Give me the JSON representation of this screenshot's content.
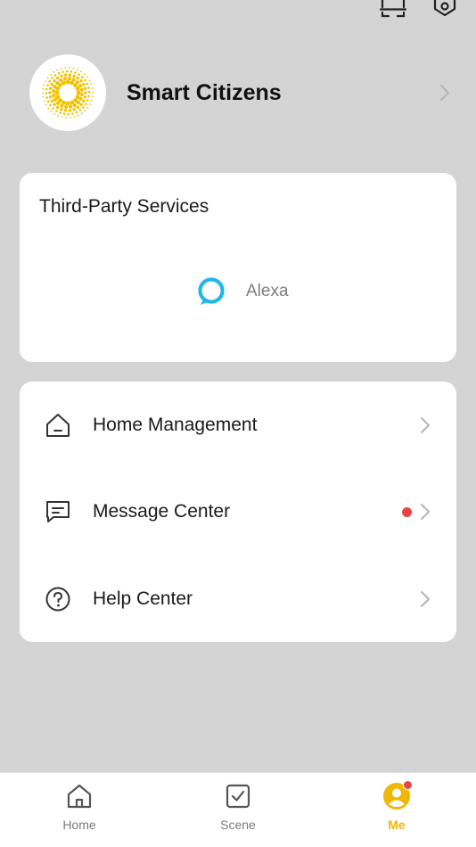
{
  "header": {
    "icons": [
      "scan-icon",
      "settings-icon"
    ]
  },
  "profile": {
    "name": "Smart Citizens",
    "avatar_icon": "sunburst-logo-icon",
    "accent_color": "#f2c200"
  },
  "third_party": {
    "title": "Third-Party Services",
    "services": [
      {
        "label": "Alexa",
        "icon": "alexa-icon",
        "color": "#1fb6e8"
      }
    ]
  },
  "menu": {
    "items": [
      {
        "label": "Home Management",
        "icon": "home-outline-icon",
        "badge": false
      },
      {
        "label": "Message Center",
        "icon": "message-icon",
        "badge": true
      },
      {
        "label": "Help Center",
        "icon": "help-circle-icon",
        "badge": false
      }
    ]
  },
  "tabbar": {
    "tabs": [
      {
        "label": "Home",
        "icon": "home-icon",
        "active": false
      },
      {
        "label": "Scene",
        "icon": "scene-check-icon",
        "active": false
      },
      {
        "label": "Me",
        "icon": "me-icon",
        "active": true,
        "badge": true
      }
    ],
    "active_color": "#f2b705"
  },
  "colors": {
    "background": "#d4d4d4",
    "card": "#ffffff",
    "badge": "#e84343"
  }
}
